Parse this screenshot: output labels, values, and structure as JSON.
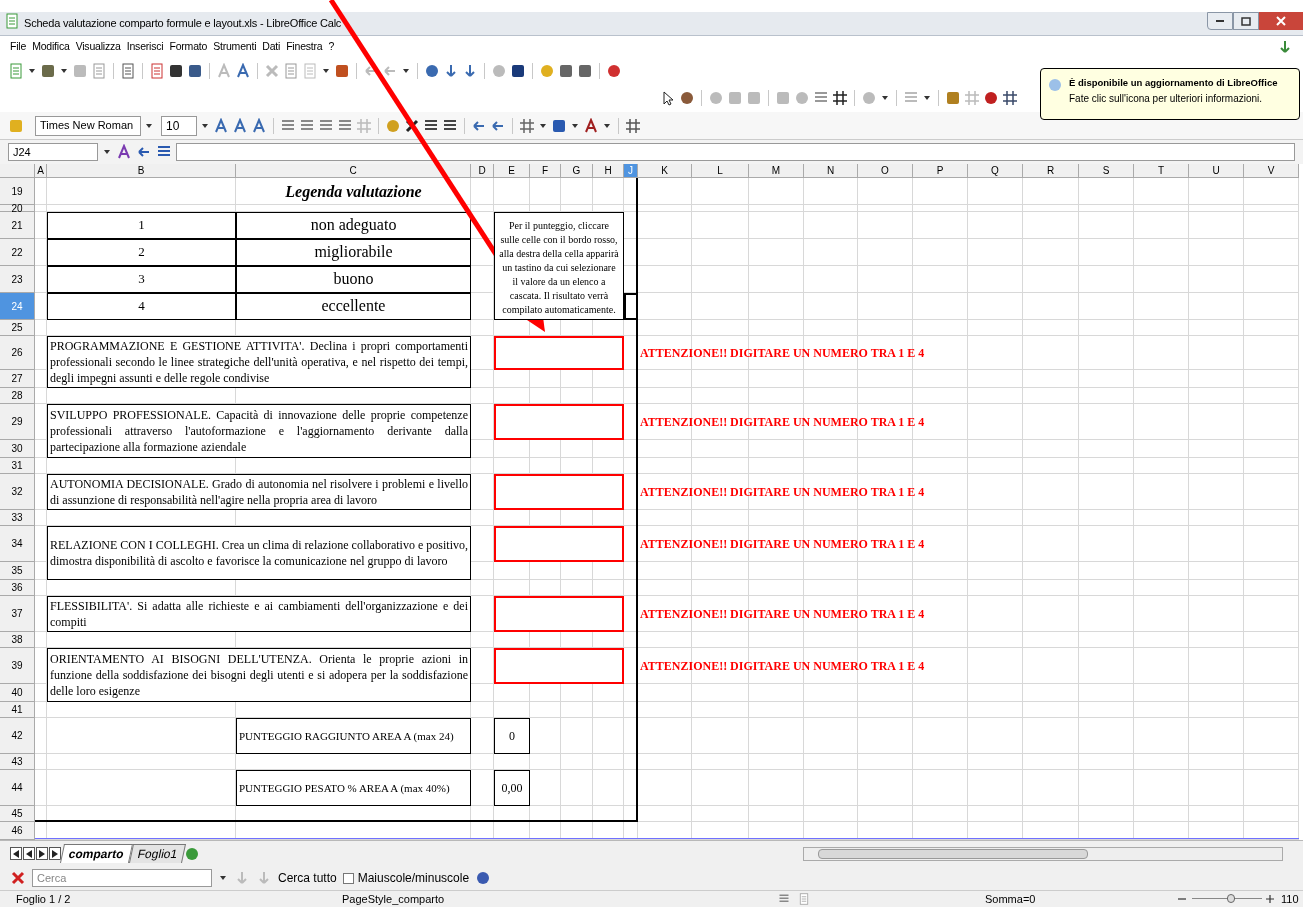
{
  "window": {
    "title": "Scheda valutazione comparto formule e layout.xls - LibreOffice Calc"
  },
  "menu": [
    "File",
    "Modifica",
    "Visualizza",
    "Inserisci",
    "Formato",
    "Strumenti",
    "Dati",
    "Finestra",
    "?"
  ],
  "formatting_toolbar": {
    "font": "Times New Roman",
    "size": "10"
  },
  "formula_bar": {
    "name_box": "J24"
  },
  "notification": {
    "title": "È disponibile un aggiornamento di LibreOffice",
    "body": "Fate clic sull'icona per ulteriori informazioni."
  },
  "columns": [
    {
      "label": "A",
      "selected": false
    },
    {
      "label": "B",
      "selected": false
    },
    {
      "label": "C",
      "selected": false
    },
    {
      "label": "D",
      "selected": false
    },
    {
      "label": "E",
      "selected": false
    },
    {
      "label": "F",
      "selected": false
    },
    {
      "label": "G",
      "selected": false
    },
    {
      "label": "H",
      "selected": false
    },
    {
      "label": "J",
      "selected": true
    },
    {
      "label": "K",
      "selected": false
    },
    {
      "label": "L",
      "selected": false
    },
    {
      "label": "M",
      "selected": false
    },
    {
      "label": "N",
      "selected": false
    },
    {
      "label": "O",
      "selected": false
    },
    {
      "label": "P",
      "selected": false
    },
    {
      "label": "Q",
      "selected": false
    },
    {
      "label": "R",
      "selected": false
    },
    {
      "label": "S",
      "selected": false
    },
    {
      "label": "T",
      "selected": false
    },
    {
      "label": "U",
      "selected": false
    },
    {
      "label": "V",
      "selected": false
    }
  ],
  "rows": [
    {
      "label": "19",
      "selected": false
    },
    {
      "label": "20",
      "selected": false
    },
    {
      "label": "21",
      "selected": false
    },
    {
      "label": "22",
      "selected": false
    },
    {
      "label": "23",
      "selected": false
    },
    {
      "label": "24",
      "selected": true
    },
    {
      "label": "25",
      "selected": false
    },
    {
      "label": "26",
      "selected": false
    },
    {
      "label": "27",
      "selected": false
    },
    {
      "label": "28",
      "selected": false
    },
    {
      "label": "29",
      "selected": false
    },
    {
      "label": "30",
      "selected": false
    },
    {
      "label": "31",
      "selected": false
    },
    {
      "label": "32",
      "selected": false
    },
    {
      "label": "33",
      "selected": false
    },
    {
      "label": "34",
      "selected": false
    },
    {
      "label": "35",
      "selected": false
    },
    {
      "label": "36",
      "selected": false
    },
    {
      "label": "37",
      "selected": false
    },
    {
      "label": "38",
      "selected": false
    },
    {
      "label": "39",
      "selected": false
    },
    {
      "label": "40",
      "selected": false
    },
    {
      "label": "41",
      "selected": false
    },
    {
      "label": "42",
      "selected": false
    },
    {
      "label": "43",
      "selected": false
    },
    {
      "label": "44",
      "selected": false
    },
    {
      "label": "45",
      "selected": false
    },
    {
      "label": "46",
      "selected": false
    }
  ],
  "sheet": {
    "legend_title": "Legenda valutazione",
    "legend": [
      {
        "score": "1",
        "label": "non adeguato"
      },
      {
        "score": "2",
        "label": "migliorabile"
      },
      {
        "score": "3",
        "label": "buono"
      },
      {
        "score": "4",
        "label": "eccellente"
      }
    ],
    "note": "Per il punteggio, cliccare sulle celle con il bordo rosso, alla destra della cella apparirà un tastino da cui selezionare il valore da un elenco a cascata. Il risultato verrà compilato automaticamente.",
    "criteria": [
      {
        "text": "PROGRAMMAZIONE E GESTIONE ATTIVITA'. Declina i propri comportamenti professionali secondo le linee strategiche dell'unità operativa, e nel rispetto dei tempi, degli impegni assunti e delle regole condivise",
        "warning": "ATTENZIONE!! DIGITARE UN NUMERO TRA 1 E 4"
      },
      {
        "text": "SVILUPPO PROFESSIONALE. Capacità di innovazione delle proprie competenze professionali attraverso l'autoformazione e l'aggiornamento derivante dalla partecipazione alla formazione aziendale",
        "warning": "ATTENZIONE!! DIGITARE UN NUMERO TRA 1 E 4"
      },
      {
        "text": "AUTONOMIA DECISIONALE. Grado di autonomia nel risolvere i problemi e livello di assunzione di responsabilità nell'agire nella propria area di lavoro",
        "warning": "ATTENZIONE!! DIGITARE UN NUMERO TRA 1 E 4"
      },
      {
        "text": "RELAZIONE CON I COLLEGHI. Crea un clima di relazione collaborativo e positivo, dimostra disponibilità di ascolto e favorisce la comunicazione nel gruppo di lavoro",
        "warning": "ATTENZIONE!! DIGITARE UN NUMERO TRA 1 E 4"
      },
      {
        "text": "FLESSIBILITA'. Si adatta alle richieste e ai cambiamenti dell'organizzazione e dei compiti",
        "warning": "ATTENZIONE!! DIGITARE UN NUMERO TRA 1 E 4"
      },
      {
        "text": "ORIENTAMENTO AI BISOGNI DELL'UTENZA. Orienta le proprie azioni in funzione della soddisfazione dei bisogni degli utenti e si adopera per la soddisfazione delle loro esigenze",
        "warning": "ATTENZIONE!! DIGITARE UN NUMERO TRA 1 E 4"
      }
    ],
    "totals": [
      {
        "label": "PUNTEGGIO RAGGIUNTO AREA A (max 24)",
        "value": "0"
      },
      {
        "label": "PUNTEGGIO PESATO % AREA A (max 40%)",
        "value": "0,00"
      }
    ]
  },
  "sheet_tabs": [
    {
      "label": "comparto",
      "selected": true
    },
    {
      "label": "Foglio1",
      "selected": false
    }
  ],
  "find_bar": {
    "placeholder": "Cerca",
    "find_all": "Cerca tutto",
    "match_case": {
      "label": "Maiuscole/minuscole",
      "checked": false
    }
  },
  "status_bar": {
    "sheet": "Foglio 1 / 2",
    "page_style": "PageStyle_comparto",
    "sum": "Somma=0",
    "zoom_slider": {
      "level": 0.55
    },
    "zoom": "110"
  }
}
